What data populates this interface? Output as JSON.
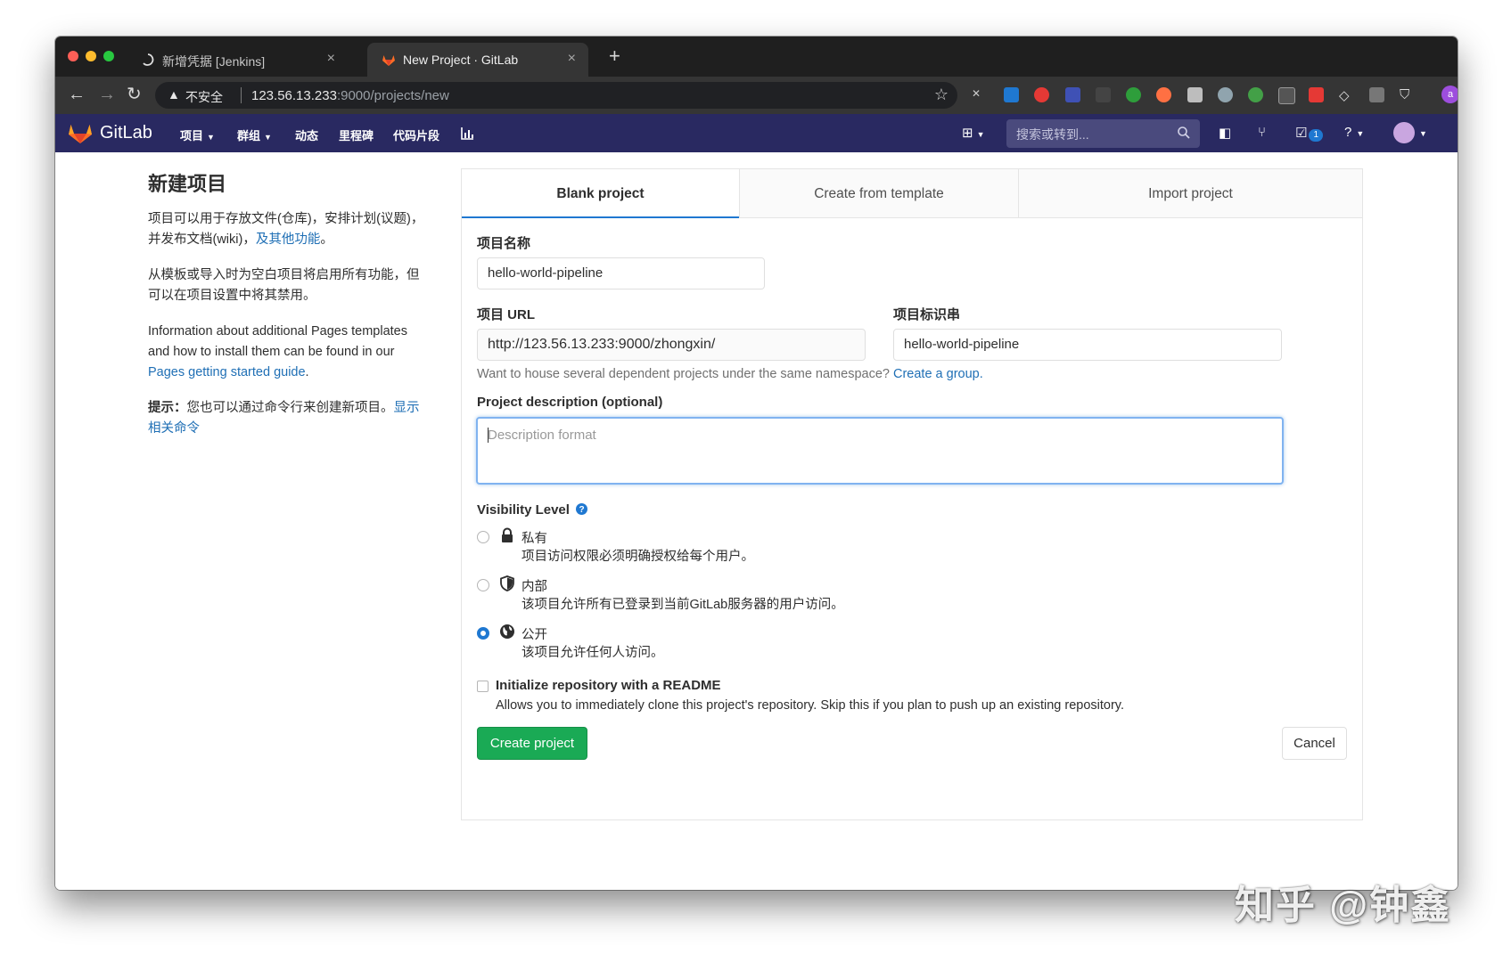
{
  "browser": {
    "tabs": [
      {
        "title": "新增凭据 [Jenkins]",
        "icon": "loading-spinner-icon"
      },
      {
        "title": "New Project · GitLab",
        "icon": "gitlab-tanuki-icon"
      }
    ],
    "address": {
      "security_label": "不安全",
      "url_host": "123.56.13.233",
      "url_rest": ":9000/projects/new"
    },
    "profile_initial": "a"
  },
  "gitlab_nav": {
    "brand": "GitLab",
    "menu": [
      "项目",
      "群组",
      "动态",
      "里程碑",
      "代码片段"
    ],
    "search_placeholder": "搜索或转到...",
    "todo_count": "1",
    "colors": {
      "nav_bg": "#292961",
      "accent": "#1f78d1",
      "create": "#1aaa55"
    }
  },
  "sidebar": {
    "title": "新建项目",
    "p1_text": "项目可以用于存放文件(仓库)，安排计划(议题)，并发布文档(wiki)，",
    "p1_link": "及其他功能",
    "p1_end": "。",
    "p2_text": "从模板或导入时为空白项目将启用所有功能，但可以在项目设置中将其禁用。",
    "p3_text": "Information about additional Pages templates and how to install them can be found in our ",
    "p3_link": "Pages getting started guide",
    "p3_end": ".",
    "p4_strong": "提示：",
    "p4_text": "您也可以通过命令行来创建新项目。",
    "p4_link": "显示相关命令"
  },
  "form": {
    "tabs": [
      "Blank project",
      "Create from template",
      "Import project"
    ],
    "name_label": "项目名称",
    "name_value": "hello-world-pipeline",
    "url_label": "项目 URL",
    "url_value": "http://123.56.13.233:9000/zhongxin/",
    "slug_label": "项目标识串",
    "slug_value": "hello-world-pipeline",
    "namespace_help": "Want to house several dependent projects under the same namespace?",
    "namespace_link": "Create a group.",
    "desc_label": "Project description (optional)",
    "desc_placeholder": "Description format",
    "visibility_label": "Visibility Level",
    "visibility": [
      {
        "title": "私有",
        "desc": "项目访问权限必须明确授权给每个用户。",
        "icon": "lock-icon",
        "checked": false
      },
      {
        "title": "内部",
        "desc": "该项目允许所有已登录到当前GitLab服务器的用户访问。",
        "icon": "shield-icon",
        "checked": false
      },
      {
        "title": "公开",
        "desc": "该项目允许任何人访问。",
        "icon": "globe-icon",
        "checked": true
      }
    ],
    "readme_label": "Initialize repository with a README",
    "readme_desc": "Allows you to immediately clone this project's repository. Skip this if you plan to push up an existing repository.",
    "create_button": "Create project",
    "cancel_button": "Cancel"
  },
  "watermark": "知乎 @钟鑫"
}
